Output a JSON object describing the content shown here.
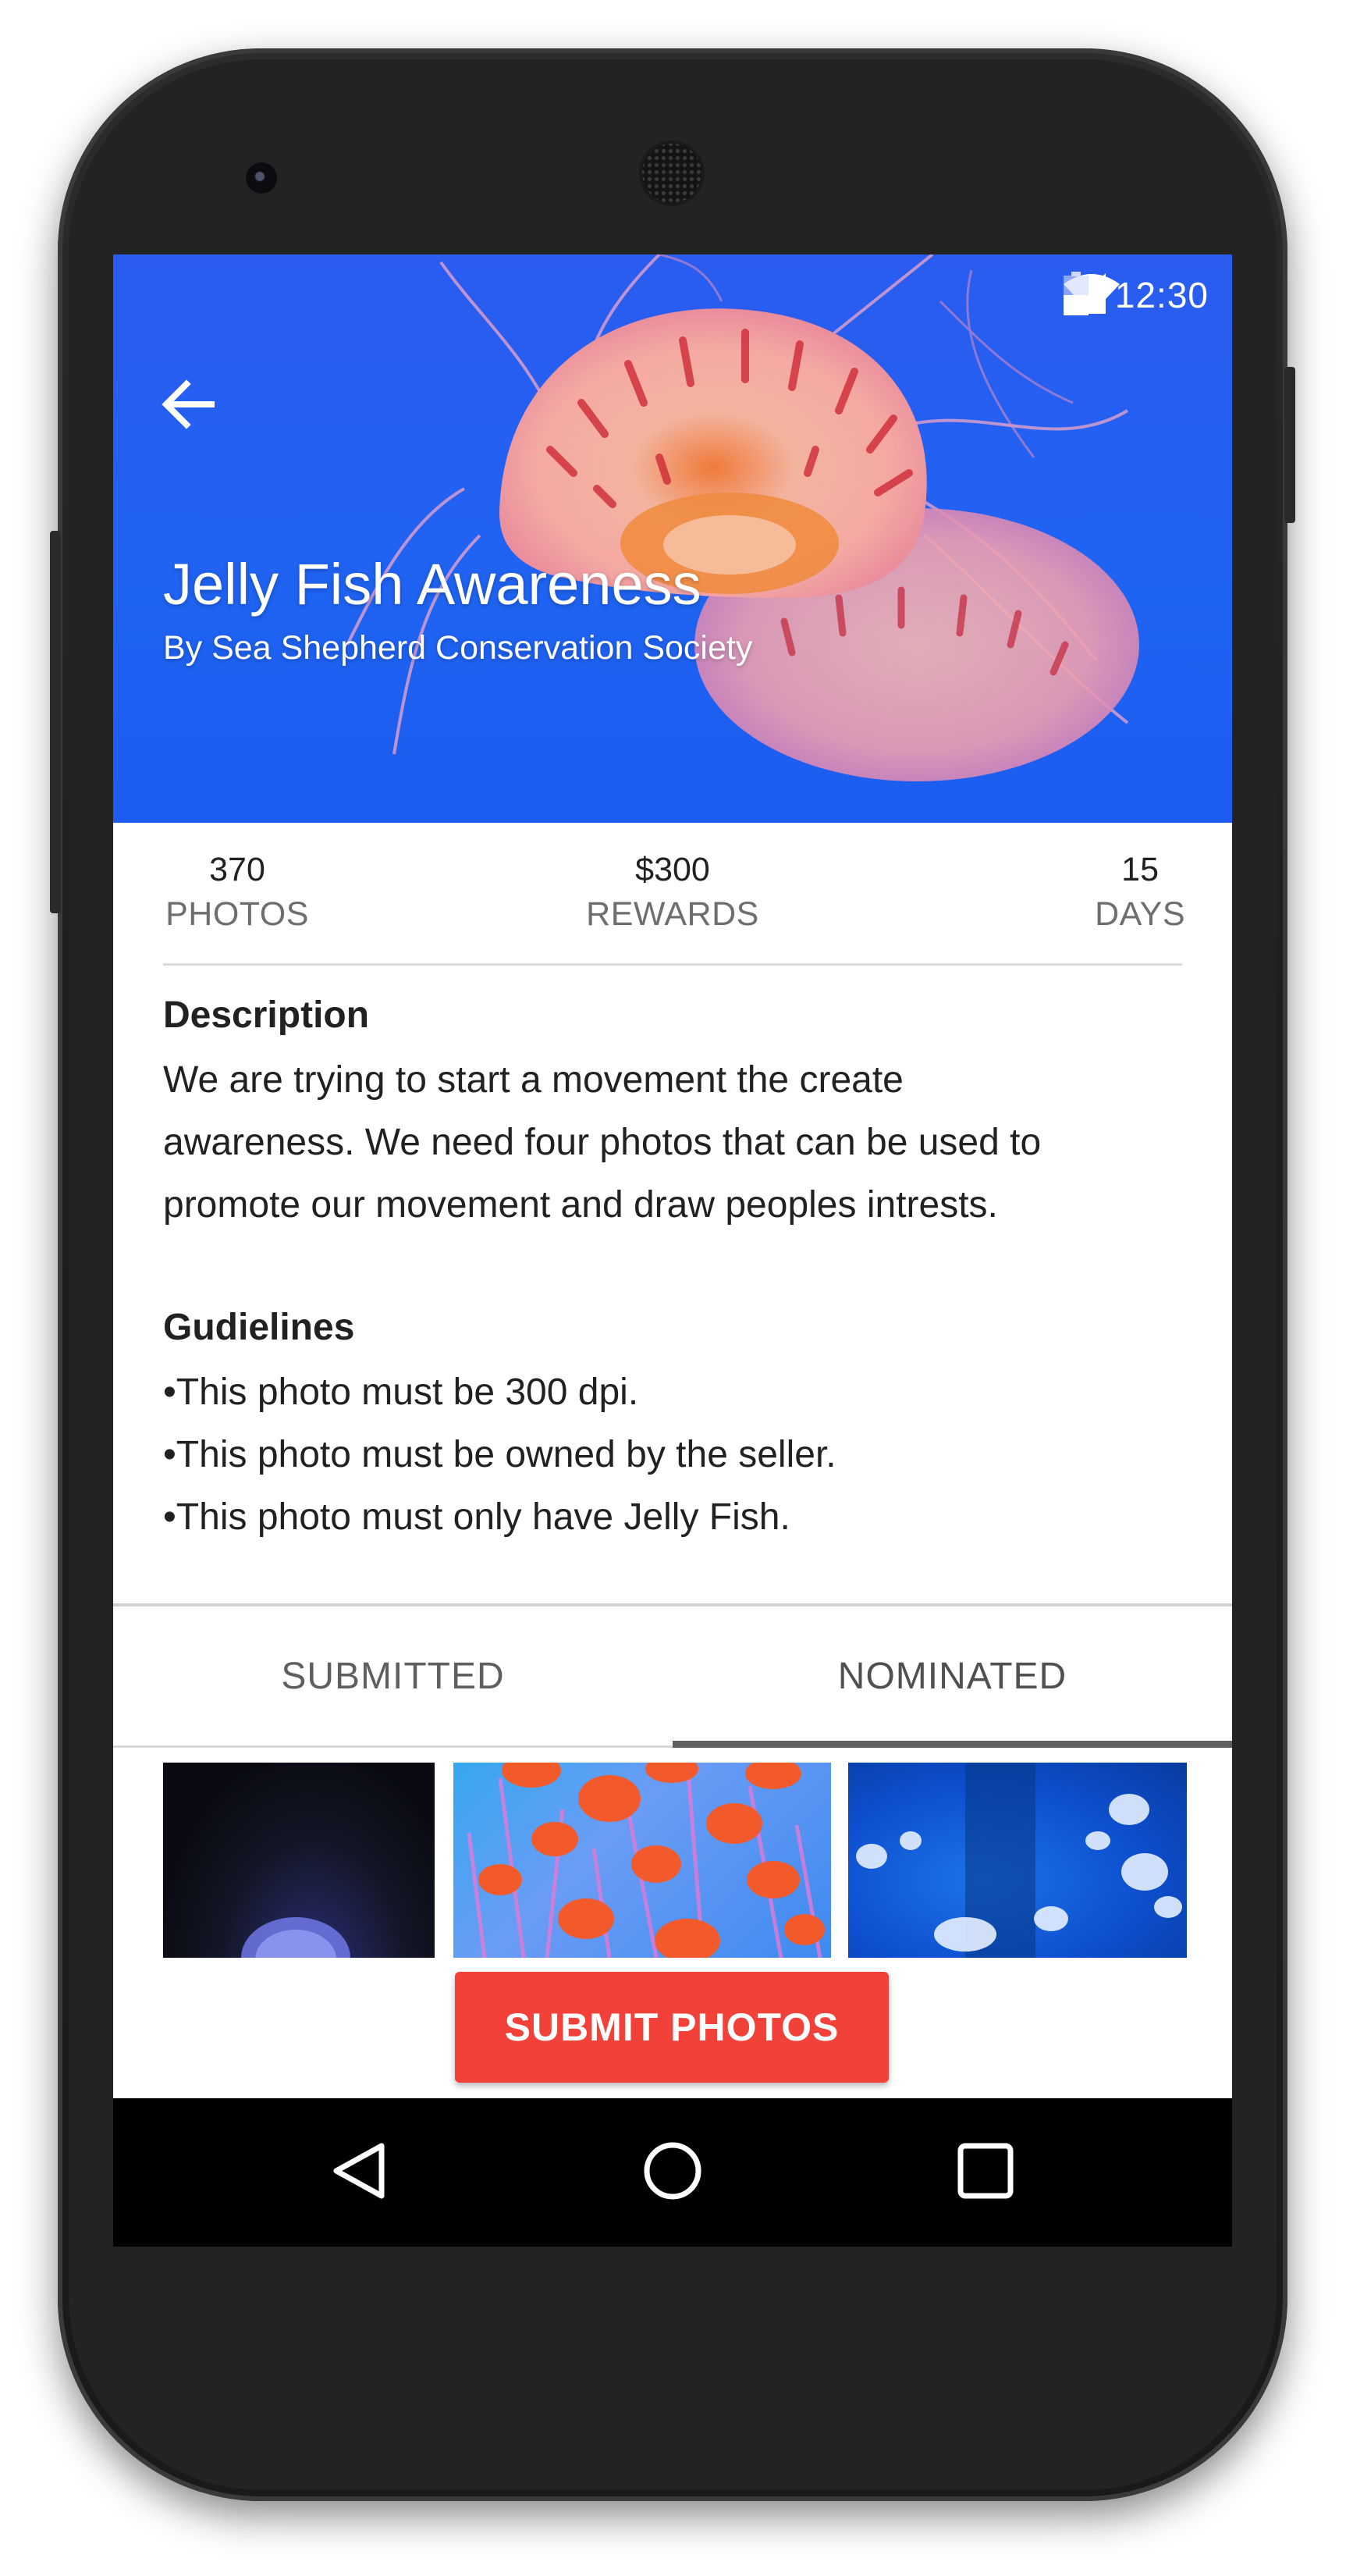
{
  "status_bar": {
    "time": "12:30",
    "icons": [
      "wifi-icon",
      "cell-signal-icon",
      "battery-icon"
    ]
  },
  "header": {
    "back_icon": "arrow-back-icon",
    "title": "Jelly Fish Awareness",
    "subtitle": "By Sea Shepherd Conservation Society",
    "background_color": "#1f63f2"
  },
  "stats": [
    {
      "value": "370",
      "label": "PHOTOS"
    },
    {
      "value": "$300",
      "label": "REWARDS"
    },
    {
      "value": "15",
      "label": "DAYS"
    }
  ],
  "description": {
    "title": "Description",
    "lines": [
      "We are trying to start a movement the create",
      "awareness. We need four photos that can be used to",
      "promote our movement and draw peoples intrests."
    ]
  },
  "guidelines": {
    "title": "Gudielines",
    "items": [
      "•This photo must be 300 dpi.",
      "•This photo must be owned by the seller.",
      "•This photo must only have Jelly Fish."
    ]
  },
  "tabs": [
    {
      "label": "SUBMITTED",
      "selected": false
    },
    {
      "label": "NOMINATED",
      "selected": true
    }
  ],
  "thumbnails": [
    "jellyfish-dark-photo",
    "jellyfish-swarm-photo",
    "jellyfish-blue-photo"
  ],
  "submit_button": {
    "label": "SUBMIT PHOTOS",
    "color": "#f24139"
  },
  "nav_bar": {
    "icons": [
      "nav-back-icon",
      "nav-home-icon",
      "nav-recents-icon"
    ]
  }
}
